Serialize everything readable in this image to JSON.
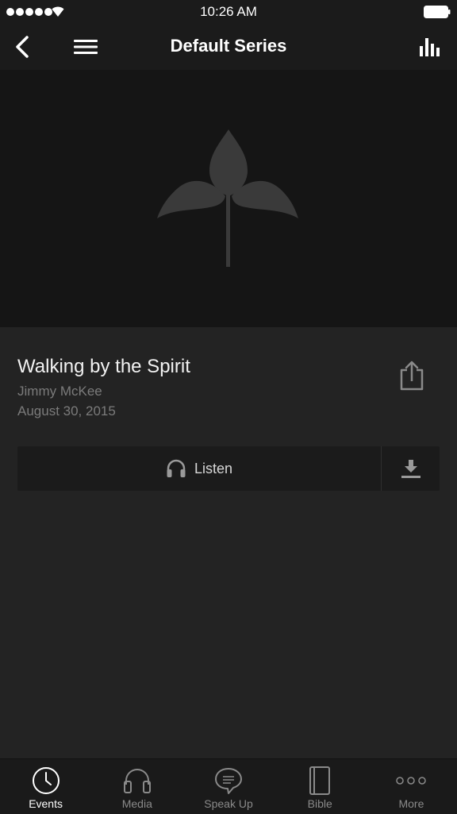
{
  "status_bar": {
    "time": "10:26 AM"
  },
  "nav": {
    "title": "Default Series"
  },
  "sermon": {
    "title": "Walking by the Spirit",
    "speaker": "Jimmy McKee",
    "date": "August 30, 2015"
  },
  "actions": {
    "listen_label": "Listen"
  },
  "tabs": [
    {
      "label": "Events",
      "icon": "clock-icon",
      "active": true
    },
    {
      "label": "Media",
      "icon": "headphones-icon",
      "active": false
    },
    {
      "label": "Speak Up",
      "icon": "speech-bubble-icon",
      "active": false
    },
    {
      "label": "Bible",
      "icon": "book-icon",
      "active": false
    },
    {
      "label": "More",
      "icon": "more-dots-icon",
      "active": false
    }
  ],
  "colors": {
    "background": "#232323",
    "bar": "#1b1b1b",
    "hero": "#151515",
    "muted_text": "#7b7b7b"
  }
}
